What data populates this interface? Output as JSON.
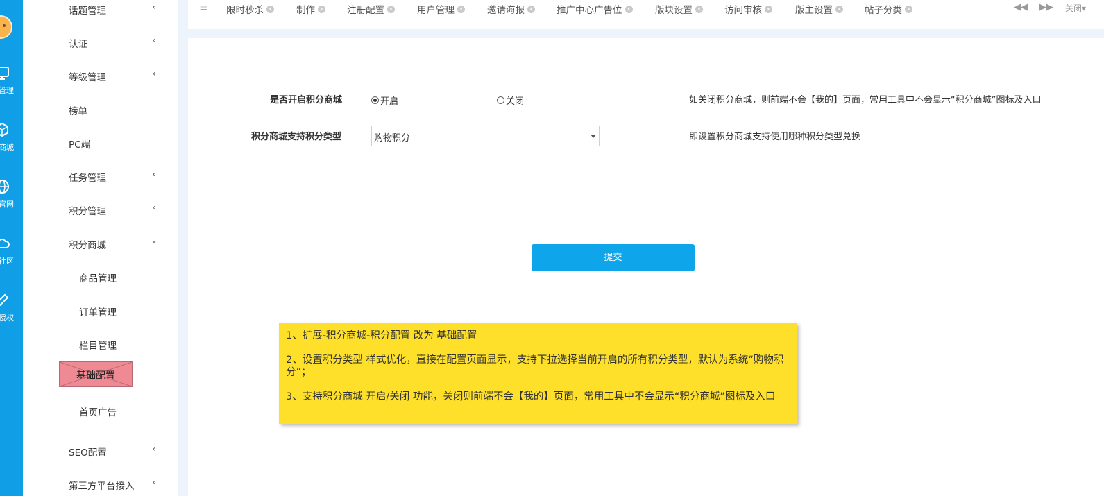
{
  "rail": {
    "items": [
      {
        "label": "管理",
        "icon": "monitor-icon"
      },
      {
        "label": "商城",
        "icon": "box-icon"
      },
      {
        "label": "官网",
        "icon": "globe-icon"
      },
      {
        "label": "社区",
        "icon": "cloud-icon"
      },
      {
        "label": "授权",
        "icon": "pen-icon"
      }
    ]
  },
  "sidebar": {
    "items": [
      {
        "label": "话题管理",
        "arrow": "‹"
      },
      {
        "label": "认证",
        "arrow": "‹"
      },
      {
        "label": "等级管理",
        "arrow": "‹"
      },
      {
        "label": "榜单",
        "arrow": ""
      },
      {
        "label": "PC端",
        "arrow": ""
      },
      {
        "label": "任务管理",
        "arrow": "‹"
      },
      {
        "label": "积分管理",
        "arrow": "‹"
      },
      {
        "label": "积分商城",
        "arrow": "⌄"
      }
    ],
    "sub_items": [
      {
        "label": "商品管理"
      },
      {
        "label": "订单管理"
      },
      {
        "label": "栏目管理"
      }
    ],
    "active_item": "基础配置",
    "after_items": [
      {
        "label": "首页广告"
      },
      {
        "label": "SEO配置",
        "arrow": "‹"
      },
      {
        "label": "第三方平台接入",
        "arrow": "‹"
      }
    ]
  },
  "tabs": {
    "menu_icon": "≡",
    "items": [
      "限时秒杀",
      "制作",
      "注册配置",
      "用户管理",
      "邀请海报",
      "推广中心广告位",
      "版块设置",
      "访问审核",
      "版主设置",
      "帖子分类"
    ],
    "prev": "◀◀",
    "next": "▶▶",
    "close_label": "关闭▾"
  },
  "form": {
    "enable_label": "是否开启积分商城",
    "enable_on": "开启",
    "enable_off": "关闭",
    "enable_value": "开启",
    "enable_hint": "如关闭积分商城，则前端不会【我的】页面，常用工具中不会显示“积分商城”图标及入口",
    "type_label": "积分商城支持积分类型",
    "type_value": "购物积分",
    "type_hint": "即设置积分商城支持使用哪种积分类型兑换",
    "submit_label": "提交"
  },
  "note": {
    "lines": [
      "1、扩展-积分商城-积分配置   改为   基础配置",
      "2、设置积分类型  样式优化，直接在配置页面显示，支持下拉选择当前开启的所有积分类型，默认为系统“购物积分”；",
      "3、支持积分商城  开启/关闭  功能，关闭则前端不会【我的】页面，常用工具中不会显示“积分商城”图标及入口"
    ]
  },
  "colors": {
    "rail": "#109fe6",
    "accent_button": "#0fa5ea",
    "note_bg": "#fee02a",
    "active_item_bg": "#ef8a94"
  }
}
